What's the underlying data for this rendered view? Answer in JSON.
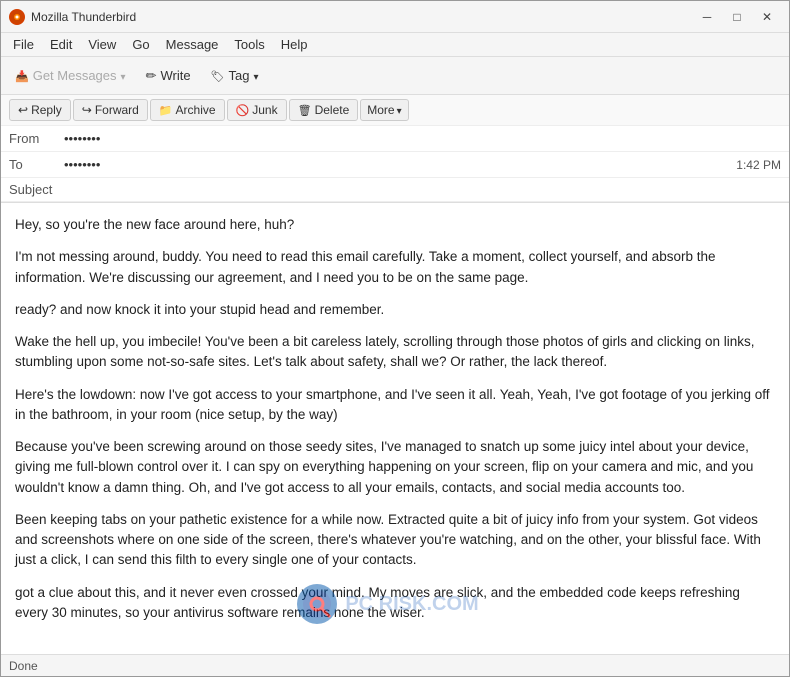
{
  "window": {
    "title": "Mozilla Thunderbird",
    "icon": "TB"
  },
  "title_controls": {
    "minimize": "─",
    "maximize": "□",
    "close": "✕"
  },
  "menu": {
    "items": [
      "File",
      "Edit",
      "View",
      "Go",
      "Message",
      "Tools",
      "Help"
    ]
  },
  "toolbar": {
    "get_messages_label": "Get Messages",
    "write_label": "Write",
    "tag_label": "Tag"
  },
  "header_toolbar": {
    "reply_label": "Reply",
    "forward_label": "Forward",
    "archive_label": "Archive",
    "junk_label": "Junk",
    "delete_label": "Delete",
    "more_label": "More"
  },
  "email_header": {
    "from_label": "From",
    "from_value": "••••••••",
    "to_label": "To",
    "to_value": "••••••••",
    "time": "1:42 PM",
    "subject_label": "Subject"
  },
  "email_body": {
    "paragraphs": [
      "Hey, so you're the new face around here, huh?",
      "I'm not messing around, buddy. You need to read this email carefully. Take a moment, collect yourself, and absorb the information. We're discussing our agreement, and I need you to be on the same page.",
      "ready? and now knock it into your stupid head and remember.",
      "Wake the hell up, you imbecile! You've been a bit careless lately, scrolling through those photos of girls and clicking on links, stumbling upon some not-so-safe sites. Let's talk about safety, shall we? Or rather, the lack thereof.",
      "Here's the lowdown: now I've got access to your smartphone, and I've seen it all. Yeah, Yeah, I've got footage of you jerking off in the bathroom, in your room (nice setup, by the way)",
      "Because you've been screwing around on those seedy sites, I've managed to snatch up some juicy intel about your device, giving me full-blown control over it. I can spy on everything happening on your screen, flip on your camera and mic, and you wouldn't know a damn thing. Oh, and I've got access to all your emails, contacts, and social media accounts too.",
      "Been keeping tabs on your pathetic existence for a while now. Extracted quite a bit of juicy info from your system. Got videos and screenshots where on one side of the screen, there's whatever you're watching, and on the other, your blissful face. With just a click, I can send this filth to every single one of your contacts.",
      "got a clue about this, and it never even crossed your mind. My moves are slick, and the embedded code keeps refreshing every 30 minutes, so your antivirus software remains none the wiser."
    ]
  },
  "status_bar": {
    "text": "Done"
  }
}
